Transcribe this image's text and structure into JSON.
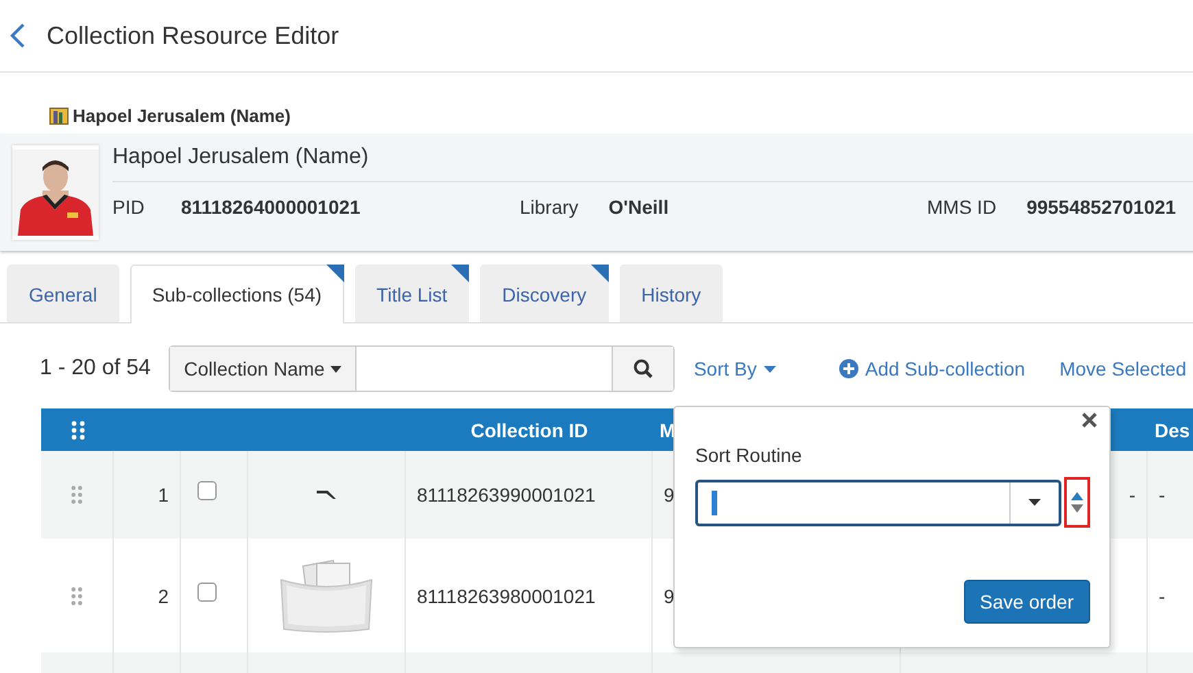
{
  "header": {
    "title": "Collection Resource Editor"
  },
  "breadcrumb": {
    "label": "Hapoel Jerusalem (Name)"
  },
  "record": {
    "name": "Hapoel Jerusalem (Name)",
    "fields": [
      {
        "label": "PID",
        "value": "81118264000001021"
      },
      {
        "label": "Library",
        "value": "O'Neill"
      },
      {
        "label": "MMS ID",
        "value": "99554852701021"
      }
    ]
  },
  "tabs": [
    {
      "label": "General",
      "selected": false,
      "flagged": false
    },
    {
      "label": "Sub-collections (54)",
      "selected": true,
      "flagged": true
    },
    {
      "label": "Title List",
      "selected": false,
      "flagged": true
    },
    {
      "label": "Discovery",
      "selected": false,
      "flagged": true
    },
    {
      "label": "History",
      "selected": false,
      "flagged": false
    }
  ],
  "toolbar": {
    "count": "1 - 20 of 54",
    "search_scope": "Collection Name",
    "sort_by": "Sort By",
    "add": "Add Sub-collection",
    "move": "Move Selected"
  },
  "table": {
    "columns": [
      {
        "kind": "grip"
      },
      {
        "kind": "blank"
      },
      {
        "kind": "blank"
      },
      {
        "kind": "blank"
      },
      {
        "kind": "text",
        "label": "Collection ID"
      },
      {
        "kind": "text",
        "label": "M"
      },
      {
        "kind": "blank"
      },
      {
        "kind": "text",
        "label": "Des"
      }
    ],
    "rows": [
      {
        "number": "1",
        "checked": false,
        "thumbnail": {
          "kind": "pen"
        },
        "collection_id": "81118263990001021",
        "column_6": "9",
        "column_7": "-",
        "column_8": "-"
      },
      {
        "number": "2",
        "checked": false,
        "thumbnail": {
          "kind": "folder"
        },
        "collection_id": "81118263980001021",
        "column_6": "9",
        "column_8": "-"
      },
      {
        "kind": "empty"
      }
    ]
  },
  "popover": {
    "label": "Sort Routine",
    "focused": true,
    "stepper_highlighted": true,
    "save": "Save order"
  }
}
